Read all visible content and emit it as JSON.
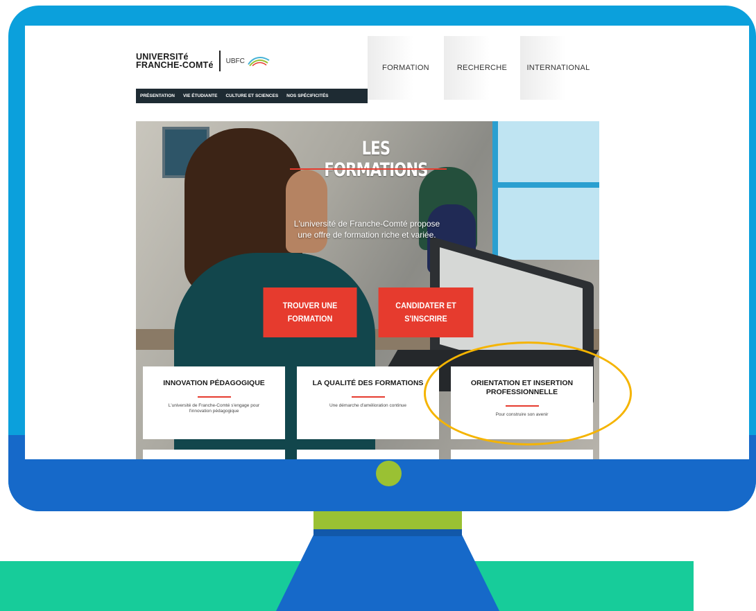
{
  "brand": {
    "logo_line1": "UNIVERSITé",
    "logo_line2": "FRANCHE-COMTé",
    "logo_ubfc": "UBFC"
  },
  "top_nav": [
    {
      "label": "FORMATION"
    },
    {
      "label": "RECHERCHE"
    },
    {
      "label": "INTERNATIONAL"
    }
  ],
  "sub_nav": [
    {
      "label": "PRÉSENTATION"
    },
    {
      "label": "VIE ÉTUDIANTE"
    },
    {
      "label": "CULTURE ET SCIENCES"
    },
    {
      "label": "NOS SPÉCIFICITÉS"
    }
  ],
  "hero": {
    "title": "LES FORMATIONS",
    "subtitle": "L'université de Franche-Comté propose une offre de formation riche et variée."
  },
  "cta": {
    "find_label": "TROUVER UNE FORMATION",
    "apply_label": "CANDIDATER ET S'INSCRIRE"
  },
  "cards": [
    {
      "title": "INNOVATION PÉDAGOGIQUE",
      "text": "L'université de Franche-Comté s'engage pour l'innovation pédagogique"
    },
    {
      "title": "LA QUALITÉ DES FORMATIONS",
      "text": "Une démarche d'amélioration continue"
    },
    {
      "title": "ORIENTATION ET INSERTION PROFESSIONNELLE",
      "text": "Pour construire son avenir"
    }
  ],
  "colors": {
    "monitor_bezel": "#0ba0dc",
    "monitor_chin": "#1669c9",
    "accent_green": "#9ac133",
    "band_teal": "#17cc9a",
    "brand_red": "#e63b2e",
    "highlight": "#f5b400"
  }
}
